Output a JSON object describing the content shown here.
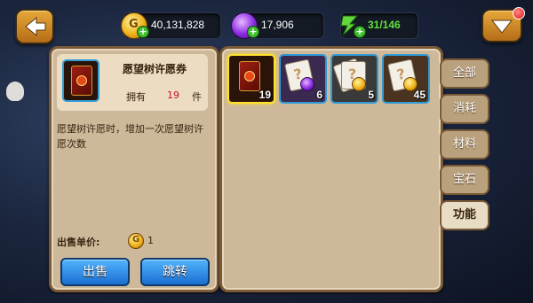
{
  "top_bar": {
    "gold": "40,131,828",
    "gems": "17,906",
    "energy": "31/146"
  },
  "detail": {
    "item_name": "愿望树许愿券",
    "own_label": "拥有",
    "own_count": "19",
    "own_unit": "件",
    "description": "愿望树许愿时，增加一次愿望树许愿次数",
    "price_label": "出售单价:",
    "price_value": "1",
    "sell_label": "出售",
    "jump_label": "跳转"
  },
  "inventory": {
    "items": [
      {
        "name": "wish-ticket",
        "count": "19",
        "selected": true
      },
      {
        "name": "mystery-card-gem",
        "count": "6"
      },
      {
        "name": "mystery-card-stack",
        "count": "5"
      },
      {
        "name": "mystery-card-coin",
        "count": "45"
      }
    ]
  },
  "tabs": [
    {
      "label": "全部"
    },
    {
      "label": "消耗"
    },
    {
      "label": "材料"
    },
    {
      "label": "宝石"
    },
    {
      "label": "功能",
      "active": true
    }
  ],
  "colors": {
    "accent": "#e6a83a",
    "panel": "#cdb89a",
    "button": "#1b6fd0",
    "energy_text": "#5fe03a"
  }
}
